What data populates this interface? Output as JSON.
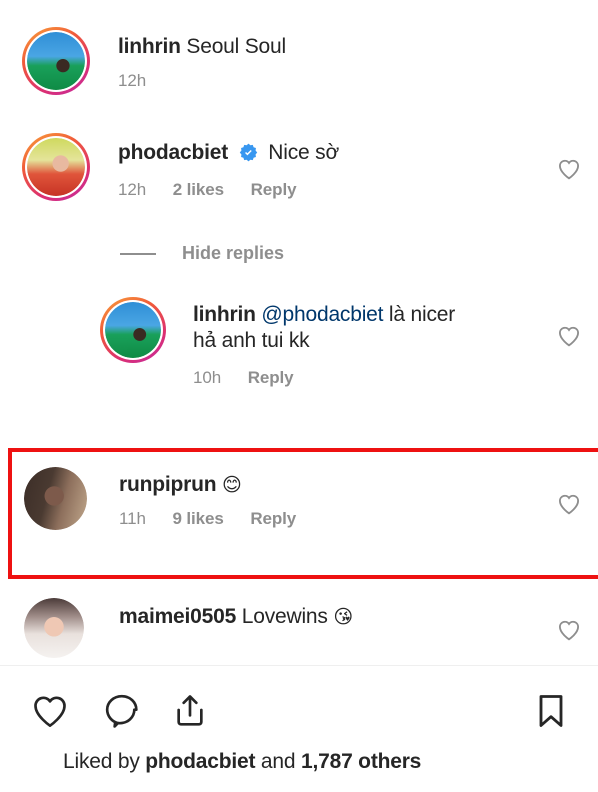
{
  "app": "instagram-post-comments",
  "colors": {
    "text": "#262626",
    "muted": "#8e8e8e",
    "mention": "#00376b",
    "verified": "#3897f0",
    "highlight": "#ee1111",
    "divider": "#efefef"
  },
  "comments": [
    {
      "id": "c1",
      "username": "linhrin",
      "text": "Seoul Soul",
      "verified": false,
      "has_story_ring": true,
      "avatar": "linhrin-avatar",
      "timestamp": "12h",
      "likes": "",
      "reply_label": "",
      "emoji": "",
      "like_icon": "heart-outline-icon",
      "show_like": false
    },
    {
      "id": "c2",
      "username": "phodacbiet",
      "text": "Nice sờ",
      "verified": true,
      "has_story_ring": true,
      "avatar": "phodacbiet-avatar",
      "timestamp": "12h",
      "likes": "2 likes",
      "reply_label": "Reply",
      "emoji": "",
      "like_icon": "heart-outline-icon",
      "show_like": true
    },
    {
      "id": "c3",
      "username": "linhrin",
      "mention": "@phodacbiet",
      "text_after_mention": " là nicer",
      "text_line2": "hả anh tui kk",
      "verified": false,
      "has_story_ring": true,
      "avatar": "linhrin-avatar",
      "timestamp": "10h",
      "likes": "",
      "reply_label": "Reply",
      "emoji": "",
      "like_icon": "heart-outline-icon",
      "show_like": true,
      "is_reply": true
    },
    {
      "id": "c4",
      "username": "runpiprun",
      "text": "",
      "emoji": "😊",
      "verified": false,
      "has_story_ring": false,
      "avatar": "runpiprun-avatar",
      "timestamp": "11h",
      "likes": "9 likes",
      "reply_label": "Reply",
      "like_icon": "heart-outline-icon",
      "show_like": true,
      "highlighted": true
    },
    {
      "id": "c5",
      "username": "maimei0505",
      "text": "Lovewins",
      "emoji": "😘",
      "verified": false,
      "has_story_ring": false,
      "avatar": "maimei0505-avatar",
      "timestamp": "",
      "likes": "",
      "reply_label": "",
      "like_icon": "heart-outline-icon",
      "show_like": true
    }
  ],
  "hide_replies": {
    "label": "Hide replies"
  },
  "action_bar": {
    "like": "heart-outline-icon",
    "comment": "comment-bubble-icon",
    "share": "share-arrow-icon",
    "save": "bookmark-outline-icon"
  },
  "liked_by": {
    "prefix": "Liked by ",
    "username": "phodacbiet",
    "middle": " and ",
    "count": "1,787 others",
    "avatar": "phodacbiet-avatar"
  }
}
